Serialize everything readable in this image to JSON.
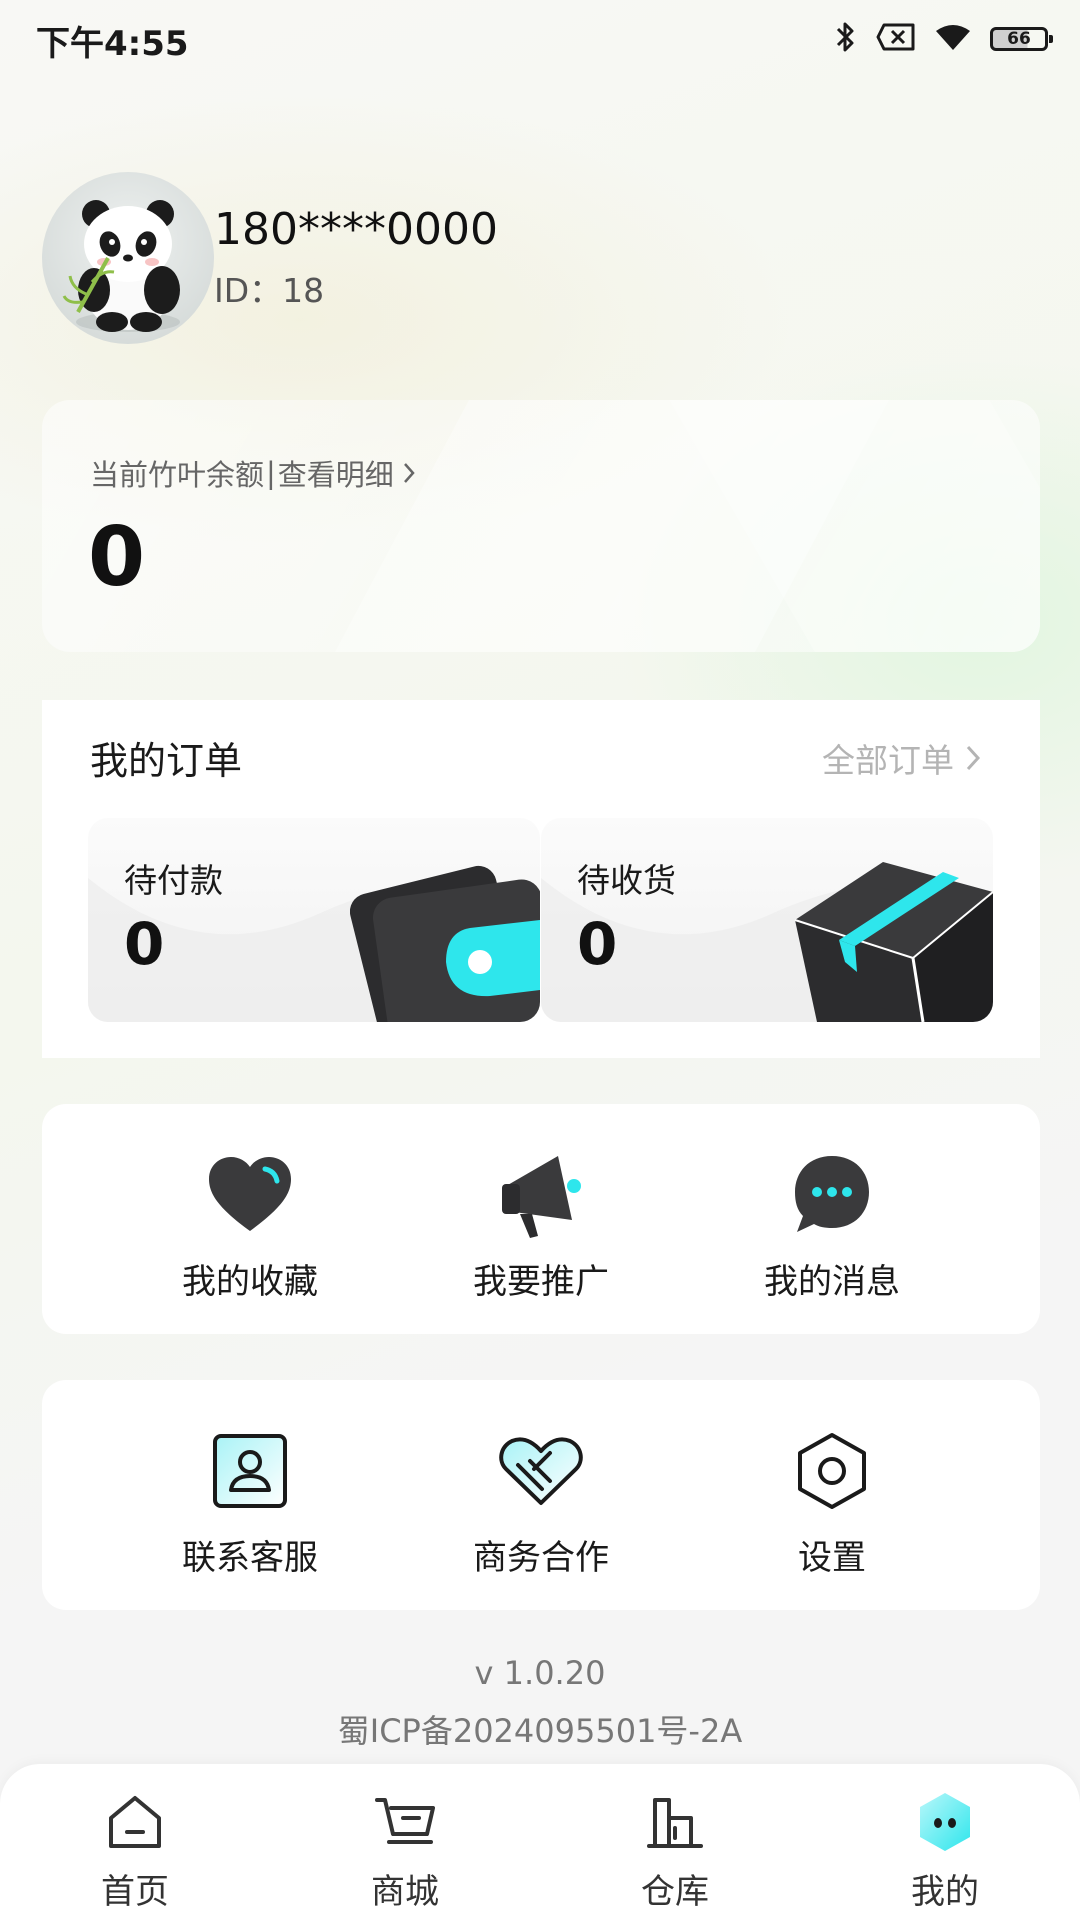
{
  "status_bar": {
    "time": "下午4:55",
    "battery": "66",
    "icons": [
      "bluetooth-icon",
      "sim-off-icon",
      "wifi-icon",
      "battery-icon"
    ]
  },
  "profile": {
    "phone": "180****0000",
    "id": "ID：18"
  },
  "balance": {
    "label": "当前竹叶余额",
    "separator": "|",
    "detail_link": "查看明细",
    "value": "0"
  },
  "orders": {
    "title": "我的订单",
    "all_link": "全部订单",
    "tiles": [
      {
        "label": "待付款",
        "count": "0",
        "icon": "wallet-icon"
      },
      {
        "label": "待收货",
        "count": "0",
        "icon": "package-box-icon"
      }
    ]
  },
  "features_row1": [
    {
      "label": "我的收藏",
      "icon": "heart-icon"
    },
    {
      "label": "我要推广",
      "icon": "megaphone-icon"
    },
    {
      "label": "我的消息",
      "icon": "chat-bubble-icon"
    }
  ],
  "features_row2": [
    {
      "label": "联系客服",
      "icon": "contact-card-icon"
    },
    {
      "label": "商务合作",
      "icon": "handshake-heart-icon"
    },
    {
      "label": "设置",
      "icon": "settings-hexagon-icon"
    }
  ],
  "footer": {
    "version": "v 1.0.20",
    "icp": "蜀ICP备2024095501号-2A"
  },
  "bottom_nav": [
    {
      "label": "首页",
      "icon": "home-icon"
    },
    {
      "label": "商城",
      "icon": "cart-icon"
    },
    {
      "label": "仓库",
      "icon": "warehouse-icon"
    },
    {
      "label": "我的",
      "icon": "profile-mascot-icon"
    }
  ],
  "colors": {
    "accent": "#2ee6ec",
    "icon_dark": "#2c2c2e",
    "text_muted": "#b4b4b4"
  }
}
